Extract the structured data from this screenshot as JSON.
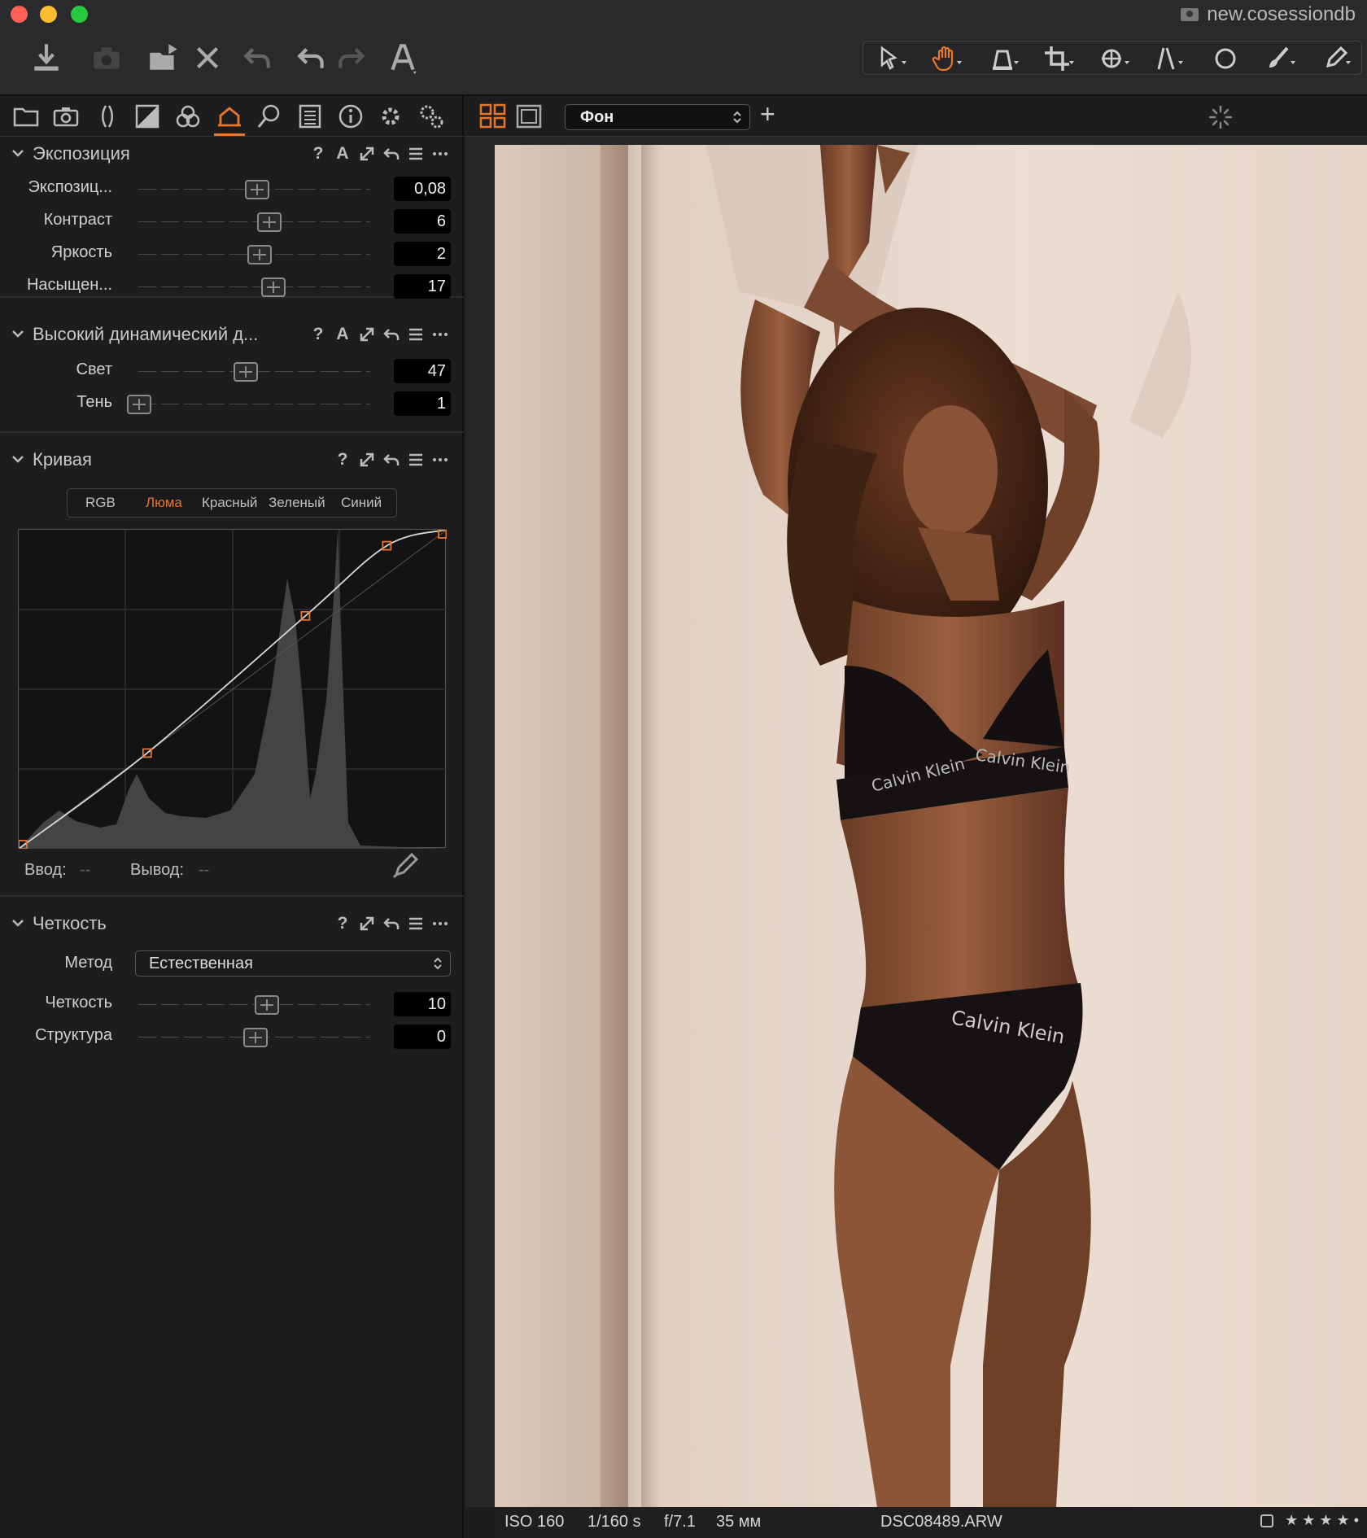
{
  "window": {
    "title": "new.cosessiondb"
  },
  "toolbar": {
    "left": [
      "import-icon",
      "camera-icon",
      "open-folder-icon",
      "delete-icon",
      "undo-all-icon",
      "undo-icon",
      "redo-icon",
      "text-icon"
    ],
    "cursor_tools": [
      "select-cursor-icon",
      "pan-hand-icon",
      "stamp-icon",
      "crop-icon",
      "rotate-icon",
      "straighten-icon",
      "circle-mask-icon",
      "brush-icon",
      "eyedropper-icon"
    ],
    "active_tool": "pan-hand-icon",
    "accent": "#e8762b"
  },
  "tool_tabs": [
    "library-icon",
    "capture-icon",
    "lens-icon",
    "exposure-icon",
    "color-icon",
    "curve-adjust-icon",
    "details-icon",
    "metadata-icon",
    "info-icon",
    "adjustments-icon",
    "settings-icon"
  ],
  "active_tab": "curve-adjust-icon",
  "exposure": {
    "title": "Экспозиция",
    "icons": [
      "?",
      "A"
    ],
    "rows": [
      {
        "label": "Экспозиц...",
        "value": "0,08",
        "level": 0.51
      },
      {
        "label": "Контраст",
        "value": "6",
        "level": 0.56
      },
      {
        "label": "Яркость",
        "value": "2",
        "level": 0.52
      },
      {
        "label": "Насыщен...",
        "value": "17",
        "level": 0.58
      }
    ]
  },
  "hdr": {
    "title": "Высокий динамический д...",
    "icons": [
      "?",
      "A"
    ],
    "rows": [
      {
        "label": "Свет",
        "value": "47",
        "level": 0.46
      },
      {
        "label": "Тень",
        "value": "1",
        "level": 0.0
      }
    ]
  },
  "curve": {
    "title": "Кривая",
    "icons": [
      "?"
    ],
    "tabs": [
      "RGB",
      "Люма",
      "Красный",
      "Зеленый",
      "Синий"
    ],
    "active_tab": "Люма",
    "input_label": "Ввод:",
    "input_value": "--",
    "output_label": "Вывод:",
    "output_value": "--",
    "points": [
      [
        0,
        0
      ],
      [
        0.3,
        0.3
      ],
      [
        0.67,
        0.73
      ],
      [
        0.86,
        0.95
      ],
      [
        1,
        1
      ]
    ]
  },
  "clarity": {
    "title": "Четкость",
    "icons": [
      "?"
    ],
    "method_label": "Метод",
    "method_value": "Естественная",
    "rows": [
      {
        "label": "Четкость",
        "value": "10",
        "level": 0.55
      },
      {
        "label": "Структура",
        "value": "0",
        "level": 0.5
      }
    ]
  },
  "viewer": {
    "variant": "Фон",
    "add_label": "+",
    "brand_text": "Calvin Klein"
  },
  "status": {
    "iso": "ISO 160",
    "shutter": "1/160 s",
    "aperture": "f/7.1",
    "focal": "35 мм",
    "filename": "DSC08489.ARW",
    "stars": "★ ★ ★ ★ •"
  }
}
